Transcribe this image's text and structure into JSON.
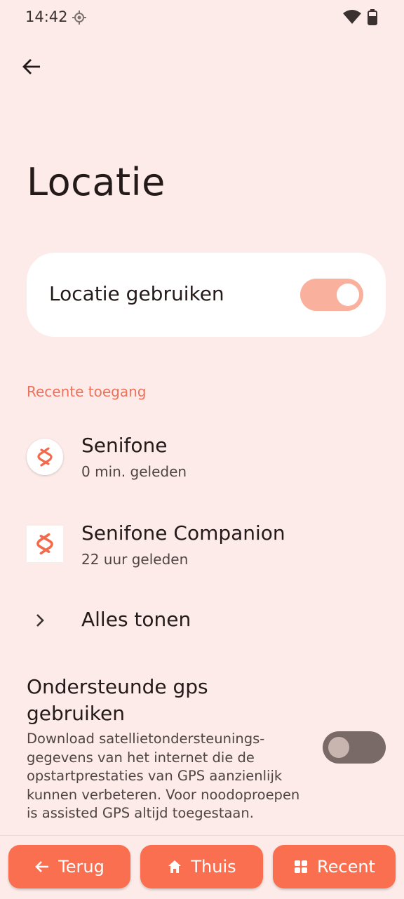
{
  "status_bar": {
    "time": "14:42"
  },
  "header": {
    "title": "Locatie"
  },
  "main_toggle": {
    "label": "Locatie gebruiken",
    "state": "on"
  },
  "recent": {
    "header": "Recente toegang",
    "items": [
      {
        "name": "Senifone",
        "time": "0 min. geleden"
      },
      {
        "name": "Senifone Companion",
        "time": "22 uur geleden"
      }
    ],
    "show_all": "Alles tonen"
  },
  "gps": {
    "title": "Ondersteunde gps gebruiken",
    "description": "Download satellietondersteunings-gegevens van het internet die de opstartprestaties van GPS aanzienlijk kunnen verbeteren. Voor noodoproepen is assisted GPS altijd toegestaan.",
    "state": "off"
  },
  "nav": {
    "back": "Terug",
    "home": "Thuis",
    "recent": "Recent"
  },
  "colors": {
    "accent": "#fb6f51",
    "background": "#fcebe8",
    "section_header": "#f0715b"
  }
}
